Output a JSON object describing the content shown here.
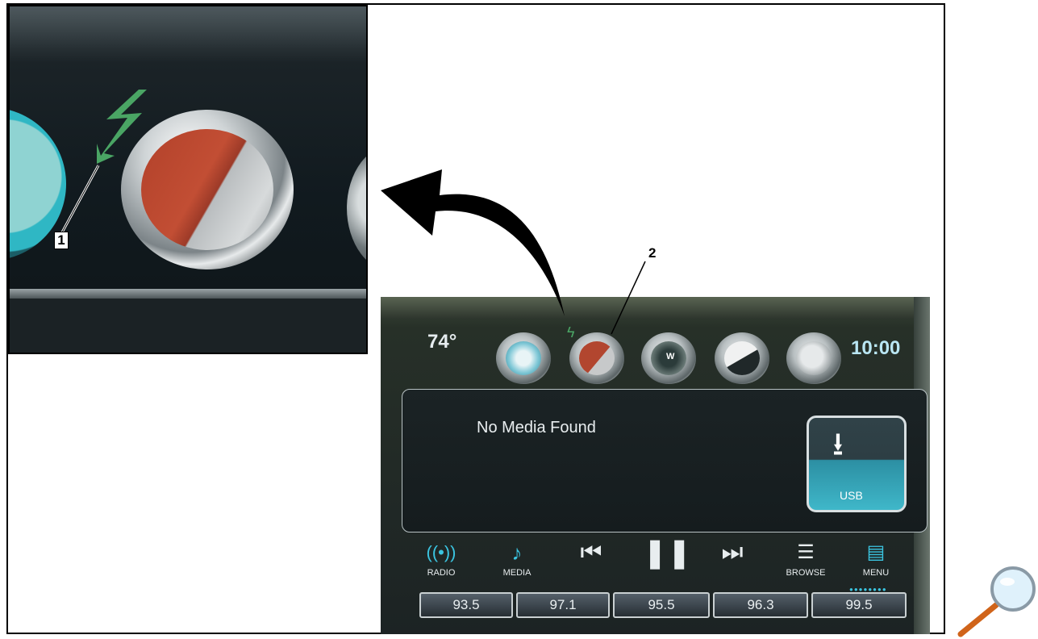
{
  "inset": {
    "callout_number": "1"
  },
  "photo": {
    "callout_number": "2",
    "temperature": "74°",
    "clock": "10:00",
    "compass_letter": "W",
    "media_status": "No Media Found",
    "usb_tile_label": "USB",
    "controls": [
      {
        "label": "RADIO",
        "icon": "radio-antenna-icon"
      },
      {
        "label": "MEDIA",
        "icon": "media-disc-icon"
      },
      {
        "label": "",
        "icon": "previous-track-icon"
      },
      {
        "label": "",
        "icon": "pause-icon"
      },
      {
        "label": "",
        "icon": "next-track-icon"
      },
      {
        "label": "BROWSE",
        "icon": "browse-list-icon"
      },
      {
        "label": "MENU",
        "icon": "menu-grid-icon"
      }
    ],
    "presets": [
      "93.5",
      "97.1",
      "95.5",
      "96.3",
      "99.5"
    ]
  },
  "colors": {
    "accent_cyan": "#3bc4e0",
    "charge_indicator_green": "#4aa564",
    "app_icon_red": "#b2412a"
  },
  "icons": {
    "enlarge": "magnifier-icon",
    "pointer_arrow": "curved-arrow-icon",
    "charge_indicator": "lightning-bolt-icon"
  }
}
